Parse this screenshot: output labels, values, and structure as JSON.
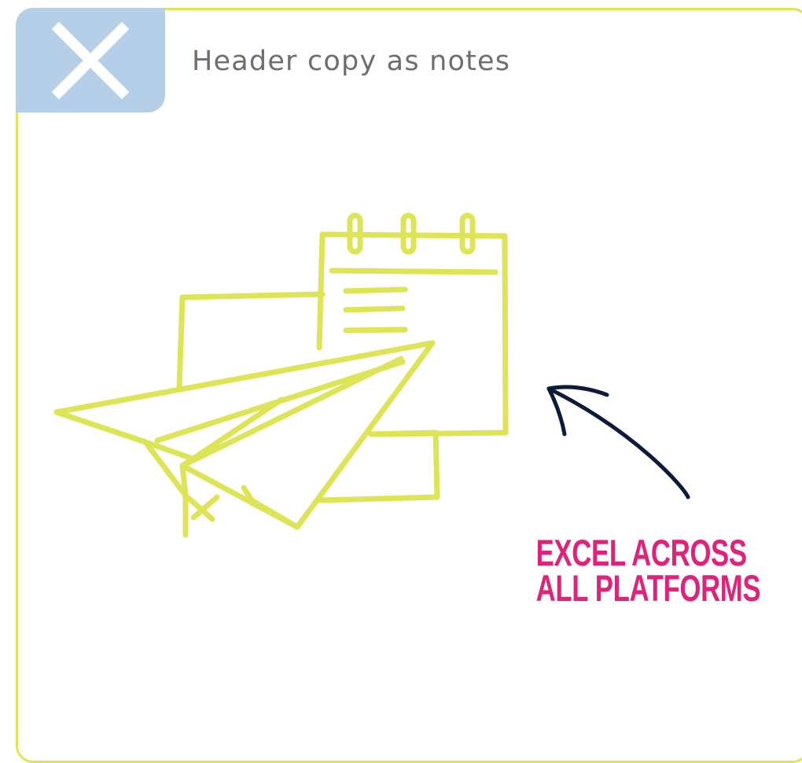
{
  "header": {
    "close_icon": "close-x-icon",
    "title": "Header copy as notes"
  },
  "illustration": {
    "icon": "paper-plane-with-calendar-notes-icon",
    "stroke_color": "#dde455"
  },
  "callout": {
    "line1": "EXCEL ACROSS",
    "line2": "ALL PLATFORMS",
    "color": "#e0237a",
    "arrow_icon": "curved-arrow-icon",
    "arrow_color": "#0e1a3c"
  },
  "colors": {
    "card_border": "#dde455",
    "close_tab_bg": "#b5cfe9",
    "header_text": "#6b6e72"
  }
}
